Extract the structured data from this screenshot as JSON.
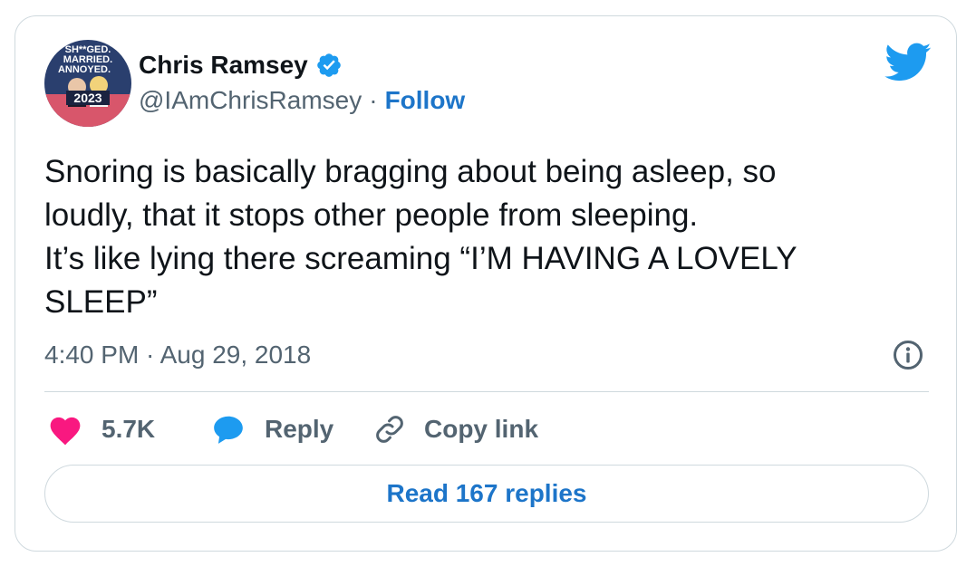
{
  "author": {
    "name": "Chris Ramsey",
    "handle": "@IAmChrisRamsey",
    "separator": "·",
    "follow_label": "Follow",
    "verified": true,
    "avatar_icon": "avatar-image",
    "avatar_text": {
      "line1": "SH**GED.",
      "line2": "MARRIED.",
      "line3": "ANNOYED.",
      "year": "2023"
    }
  },
  "tweet": {
    "text": "Snoring is basically bragging about being asleep, so\nloudly, that it stops other people from sleeping.\nIt’s like lying there screaming “I’M HAVING A LOVELY\nSLEEP”",
    "timestamp": "4:40 PM · Aug 29, 2018"
  },
  "actions": {
    "like_count": "5.7K",
    "reply_label": "Reply",
    "copy_link_label": "Copy link"
  },
  "footer": {
    "read_replies_label": "Read 167 replies"
  },
  "colors": {
    "brand_blue": "#1d9bf0",
    "link_blue": "#1d75c9",
    "like_pink": "#f91880",
    "text_primary": "#0f1419",
    "text_secondary": "#536471",
    "border": "#cfd9de"
  }
}
